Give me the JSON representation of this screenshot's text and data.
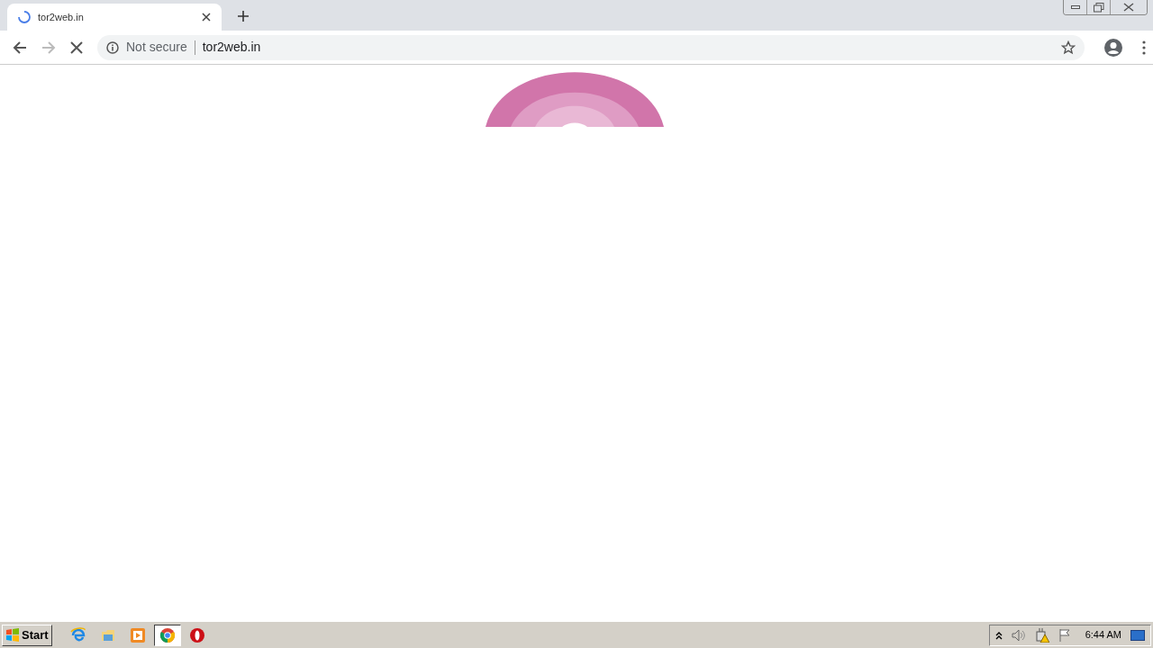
{
  "tab": {
    "title": "tor2web.in",
    "loading": true
  },
  "address_bar": {
    "security": "Not secure",
    "url": "tor2web.in"
  },
  "taskbar": {
    "start": "Start",
    "apps": [
      {
        "kind": "ie",
        "selected": false
      },
      {
        "kind": "folder",
        "selected": false
      },
      {
        "kind": "media",
        "selected": false
      },
      {
        "kind": "chrome",
        "selected": true
      },
      {
        "kind": "opera",
        "selected": false
      }
    ],
    "clock": "6:44 AM"
  }
}
